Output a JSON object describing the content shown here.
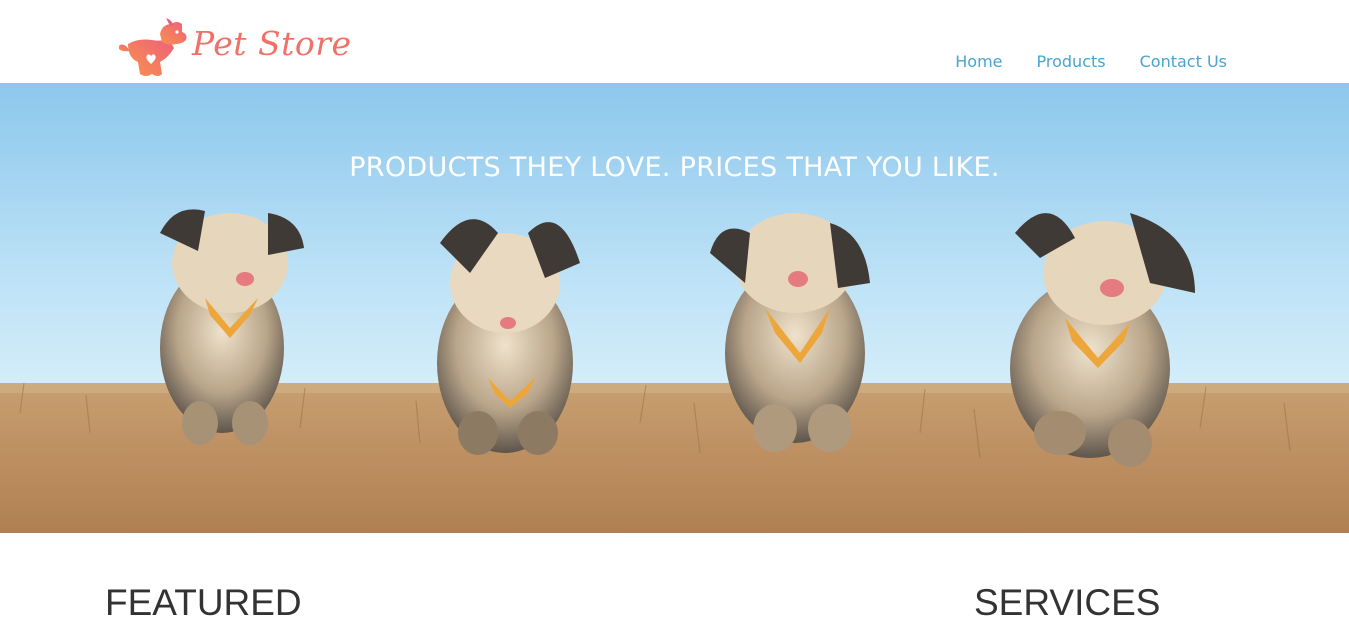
{
  "brand": {
    "name": "Pet Store",
    "logo_color": "#ef7168",
    "logo_icon": "dog-icon"
  },
  "nav": {
    "items": [
      {
        "label": "Home"
      },
      {
        "label": "Products"
      },
      {
        "label": "Contact Us"
      }
    ],
    "link_color": "#4aa3d0"
  },
  "hero": {
    "tagline": "PRODUCTS THEY LOVE. PRICES THAT YOU LIKE.",
    "image": "four-dogs-running-in-field"
  },
  "sections": {
    "featured_title": "FEATURED",
    "services_title": "SERVICES"
  }
}
